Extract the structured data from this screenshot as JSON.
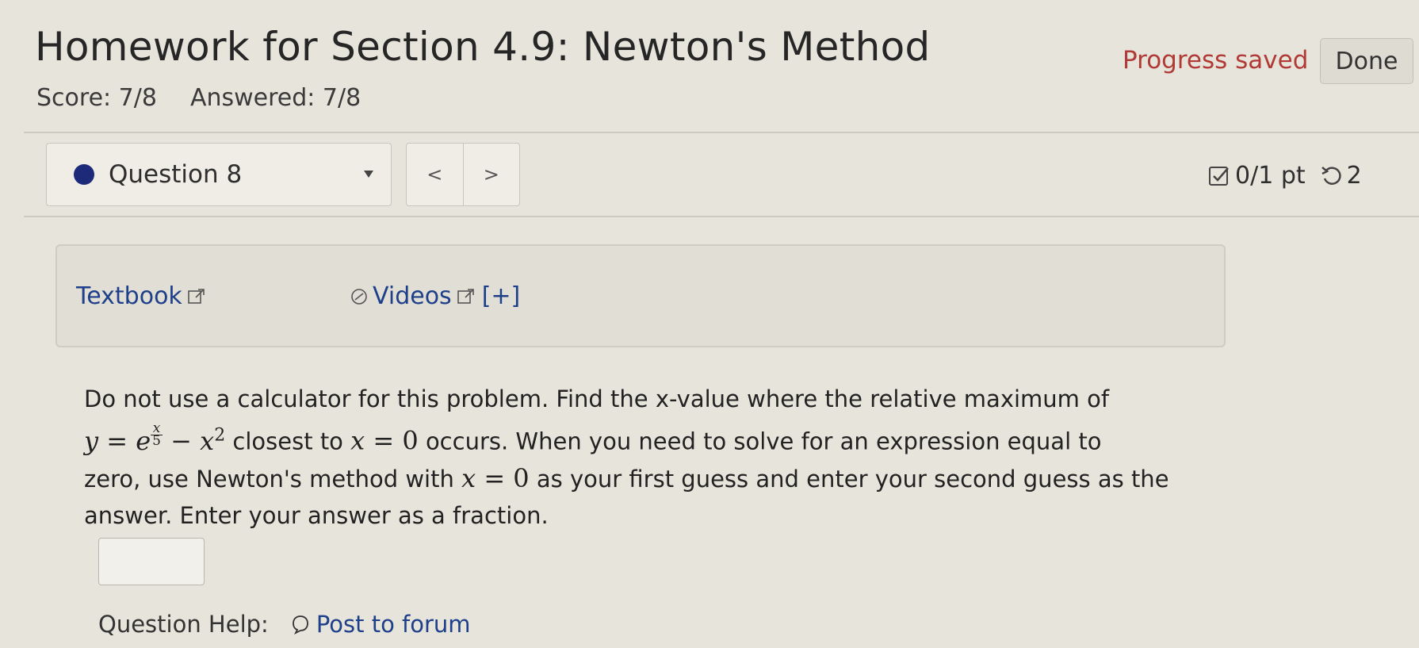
{
  "header": {
    "title": "Homework for Section 4.9: Newton's Method",
    "score": "Score: 7/8",
    "answered": "Answered: 7/8",
    "progress_status": "Progress saved",
    "done_label": "Done"
  },
  "question_nav": {
    "selected": "Question 8",
    "prev_label": "<",
    "next_label": ">",
    "points": "0/1 pt",
    "retries": "2"
  },
  "resources": {
    "textbook_label": "Textbook",
    "videos_label": "Videos",
    "expand_label": "[+]"
  },
  "problem": {
    "line1": "Do not use a calculator for this problem. Find the x-value where the relative maximum of",
    "eq_y": "y",
    "eq_equals": "=",
    "eq_base": "e",
    "eq_frac_num": "x",
    "eq_frac_den": "5",
    "eq_minus": "−",
    "eq_x": "x",
    "eq_exp": "2",
    "text_closest": "closest to",
    "x0_var": "x",
    "x0_equals": "=",
    "x0_val": "0",
    "text_occurs": "occurs. When you need to solve for an expression equal to",
    "text_zero_use": "zero, use Newton's method with",
    "x0b_var": "x",
    "x0b_equals": "=",
    "x0b_val": "0",
    "text_first_guess": "as your first guess and enter your second guess as the",
    "line4": "answer. Enter your answer as a fraction."
  },
  "answer": {
    "value": ""
  },
  "help": {
    "label": "Question Help:",
    "post_forum": "Post to forum"
  }
}
